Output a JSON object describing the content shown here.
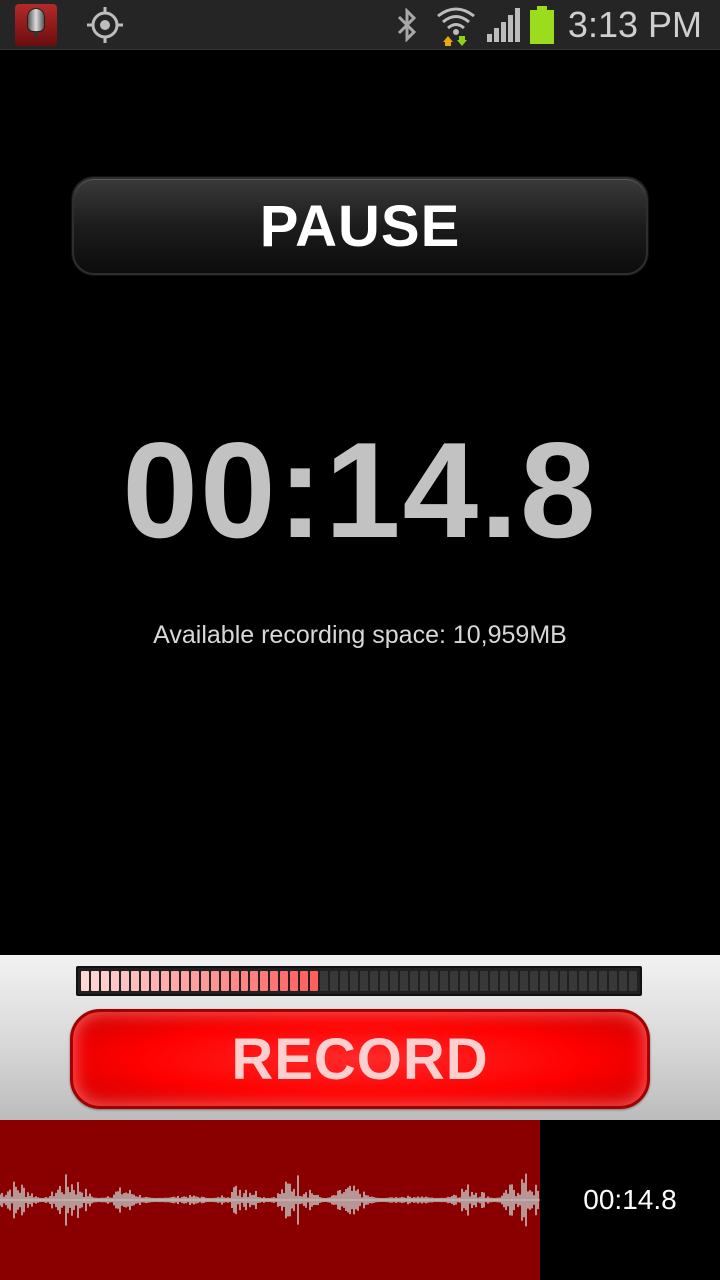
{
  "status_bar": {
    "time": "3:13 PM",
    "icons": [
      "app-icon",
      "gps-icon",
      "bluetooth-icon",
      "wifi-icon",
      "signal-icon",
      "battery-icon"
    ],
    "battery_color": "#9bdc1d"
  },
  "recorder": {
    "pause_label": "PAUSE",
    "elapsed_time": "00:14.8",
    "available_space": "Available recording space: 10,959MB",
    "record_label": "RECORD",
    "input_level_fraction": 0.43,
    "waveform_time": "00:14.8"
  },
  "colors": {
    "record_red": "#ff0000",
    "waveform_bg": "#8a0000",
    "timer_gray": "#c2c2c2"
  }
}
